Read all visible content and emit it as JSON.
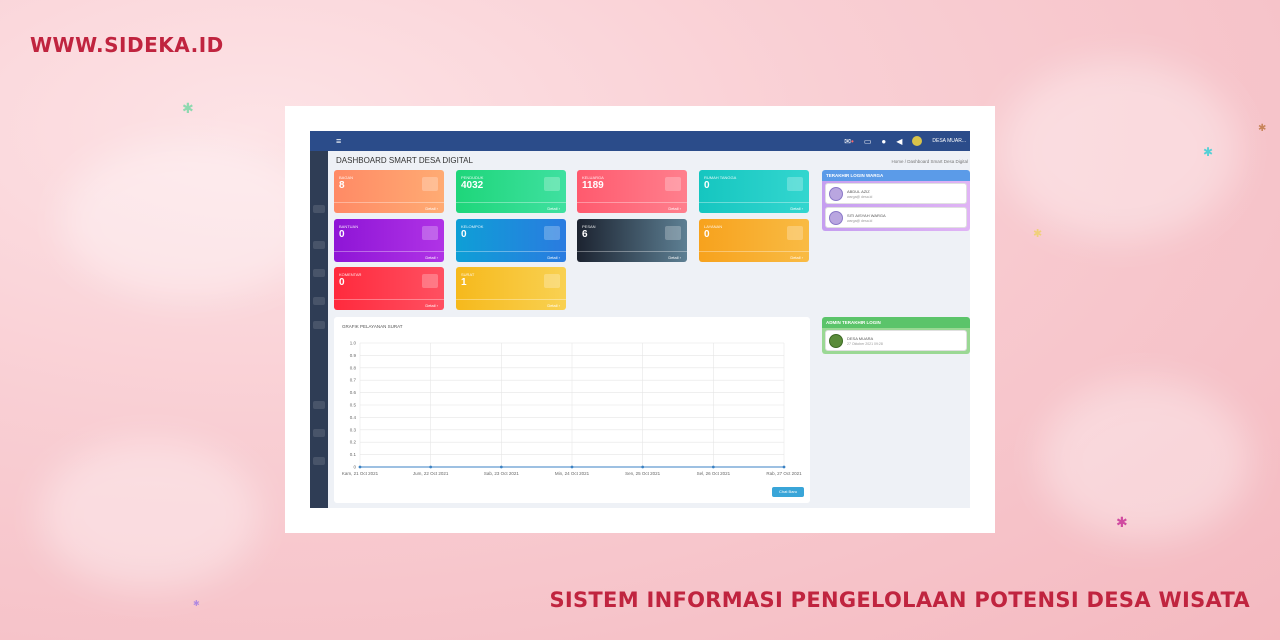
{
  "banner": {
    "site_url": "WWW.SIDEKA.ID",
    "title": "SISTEM INFORMASI PENGELOLAAN POTENSI DESA WISATA"
  },
  "colors": {
    "brand_red": "#c0243f",
    "topbar": "#2b4c8a",
    "sidebar": "#2f3d55"
  },
  "app": {
    "topbar": {
      "menu_icon": "hamburger-icon",
      "icons": [
        "mail-icon",
        "message-icon",
        "chat-icon",
        "megaphone-icon"
      ],
      "village_name": "DESA MUAR..."
    },
    "page_title": "DASHBOARD SMART DESA DIGITAL",
    "breadcrumb": "Home  /  Dashboard Smart Desa Digital",
    "cards": [
      {
        "label": "BAGAN",
        "value": "8",
        "footer": "Detail",
        "color_from": "#ff8a65",
        "color_to": "#ffab73"
      },
      {
        "label": "PENDUDUK",
        "value": "4032",
        "footer": "Detail",
        "color_from": "#1ed67a",
        "color_to": "#3fe0a0"
      },
      {
        "label": "KELUARGA",
        "value": "1189",
        "footer": "Detail",
        "color_from": "#ff5a6e",
        "color_to": "#ff7f8d"
      },
      {
        "label": "RUMAH TANGGA",
        "value": "0",
        "footer": "Detail",
        "color_from": "#15c6c0",
        "color_to": "#33d6cf"
      },
      {
        "label": "BANTUAN",
        "value": "0",
        "footer": "Detail",
        "color_from": "#8e15d6",
        "color_to": "#b033e6"
      },
      {
        "label": "KELOMPOK",
        "value": "0",
        "footer": "Detail",
        "color_from": "#0e9fd6",
        "color_to": "#2a7be0"
      },
      {
        "label": "PESAN",
        "value": "6",
        "footer": "Detail",
        "color_from": "#1c2330",
        "color_to": "#5d7f93"
      },
      {
        "label": "LAYANAN",
        "value": "0",
        "footer": "Detail",
        "color_from": "#f7a21d",
        "color_to": "#f9bb44"
      },
      {
        "label": "KOMENTAR",
        "value": "0",
        "footer": "Detail",
        "color_from": "#ff2a3d",
        "color_to": "#ff5061"
      },
      {
        "label": "SURAT",
        "value": "1",
        "footer": "Detail",
        "color_from": "#f6b91c",
        "color_to": "#f9d152"
      }
    ],
    "login_panel": {
      "title": "TERAKHIR LOGIN WARGA",
      "users": [
        {
          "name": "ABDUL AZIZ",
          "meta": "warga@ desa.id"
        },
        {
          "name": "SITI AISYAH WARGA",
          "meta": "warga@ desa.id"
        }
      ]
    },
    "admin_panel": {
      "title": "ADMIN TERAKHIR LOGIN",
      "users": [
        {
          "name": "DESA MUARA",
          "meta": "27 Oktober 2021 09:28"
        }
      ]
    },
    "chart_button": "Chat Baru"
  },
  "chart_data": {
    "type": "line",
    "title": "GRAFIK PELAYANAN SURAT",
    "xlabel": "",
    "ylabel": "",
    "x": [
      "Kam, 21 Oct 2021",
      "Jum, 22 Oct 2021",
      "Sab, 23 Oct 2021",
      "Min, 24 Oct 2021",
      "Sen, 25 Oct 2021",
      "Sel, 26 Oct 2021",
      "Rab, 27 Oct 2021"
    ],
    "y_ticks": [
      "0",
      "0.1",
      "0.2",
      "0.3",
      "0.4",
      "0.5",
      "0.6",
      "0.7",
      "0.8",
      "0.9",
      "1.0"
    ],
    "ylim": [
      0,
      1.0
    ],
    "series": [
      {
        "values": [
          0,
          0,
          0,
          0,
          0,
          0,
          0
        ],
        "color": "#3b82c4"
      }
    ],
    "grid": true
  }
}
